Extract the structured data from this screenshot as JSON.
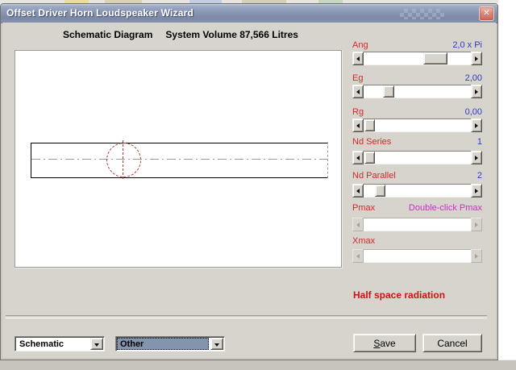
{
  "window": {
    "title": "Offset Driver Horn Loudspeaker Wizard",
    "close_glyph": "✕"
  },
  "header": {
    "left": "Schematic Diagram",
    "right": "System Volume 87,566 Litres"
  },
  "schematic": {
    "duct_outline_color": "#000000",
    "center_line_color": "#999999",
    "driver_circle_color": "#A83838"
  },
  "controls": {
    "rows": [
      {
        "label": "Ang",
        "value": "2,0 x Pi",
        "value_style": "color:#2F3BC3",
        "thumb_style": "left:74px;width:30px"
      },
      {
        "label": "Eg",
        "value": "2,00",
        "value_style": "color:#2F3BC3",
        "thumb_style": "left:24px;width:14px"
      },
      {
        "label": "Rg",
        "value": "0,00",
        "value_style": "color:#2F3BC3",
        "thumb_style": "left:1px;width:13px"
      },
      {
        "label": "Nd Series",
        "value": "1",
        "value_style": "color:#2F3BC3",
        "thumb_style": "left:1px;width:13px"
      },
      {
        "label": "Nd Parallel",
        "value": "2",
        "value_style": "color:#2F3BC3",
        "thumb_style": "left:14px;width:13px"
      },
      {
        "label": "Pmax",
        "value": "Double-click Pmax",
        "value_style": "color:#C92ECB",
        "thumb_style": "display:none"
      },
      {
        "label": "Xmax",
        "value": "",
        "value_style": "color:#2F3BC3",
        "thumb_style": "display:none"
      }
    ]
  },
  "note": "Half space radiation",
  "combos": {
    "view": "Schematic",
    "type": "Other"
  },
  "buttons": {
    "save_mnemonic": "S",
    "save_rest": "ave",
    "cancel": "Cancel"
  },
  "colors": {
    "label_red": "#CE2A2A",
    "value_blue": "#2F3BC3",
    "magenta": "#C92ECB",
    "note_red": "#CC1414",
    "titlebar_blue": "#8794B1",
    "selection_blue": "#8394AE",
    "client_gray": "#D7D4CE"
  }
}
